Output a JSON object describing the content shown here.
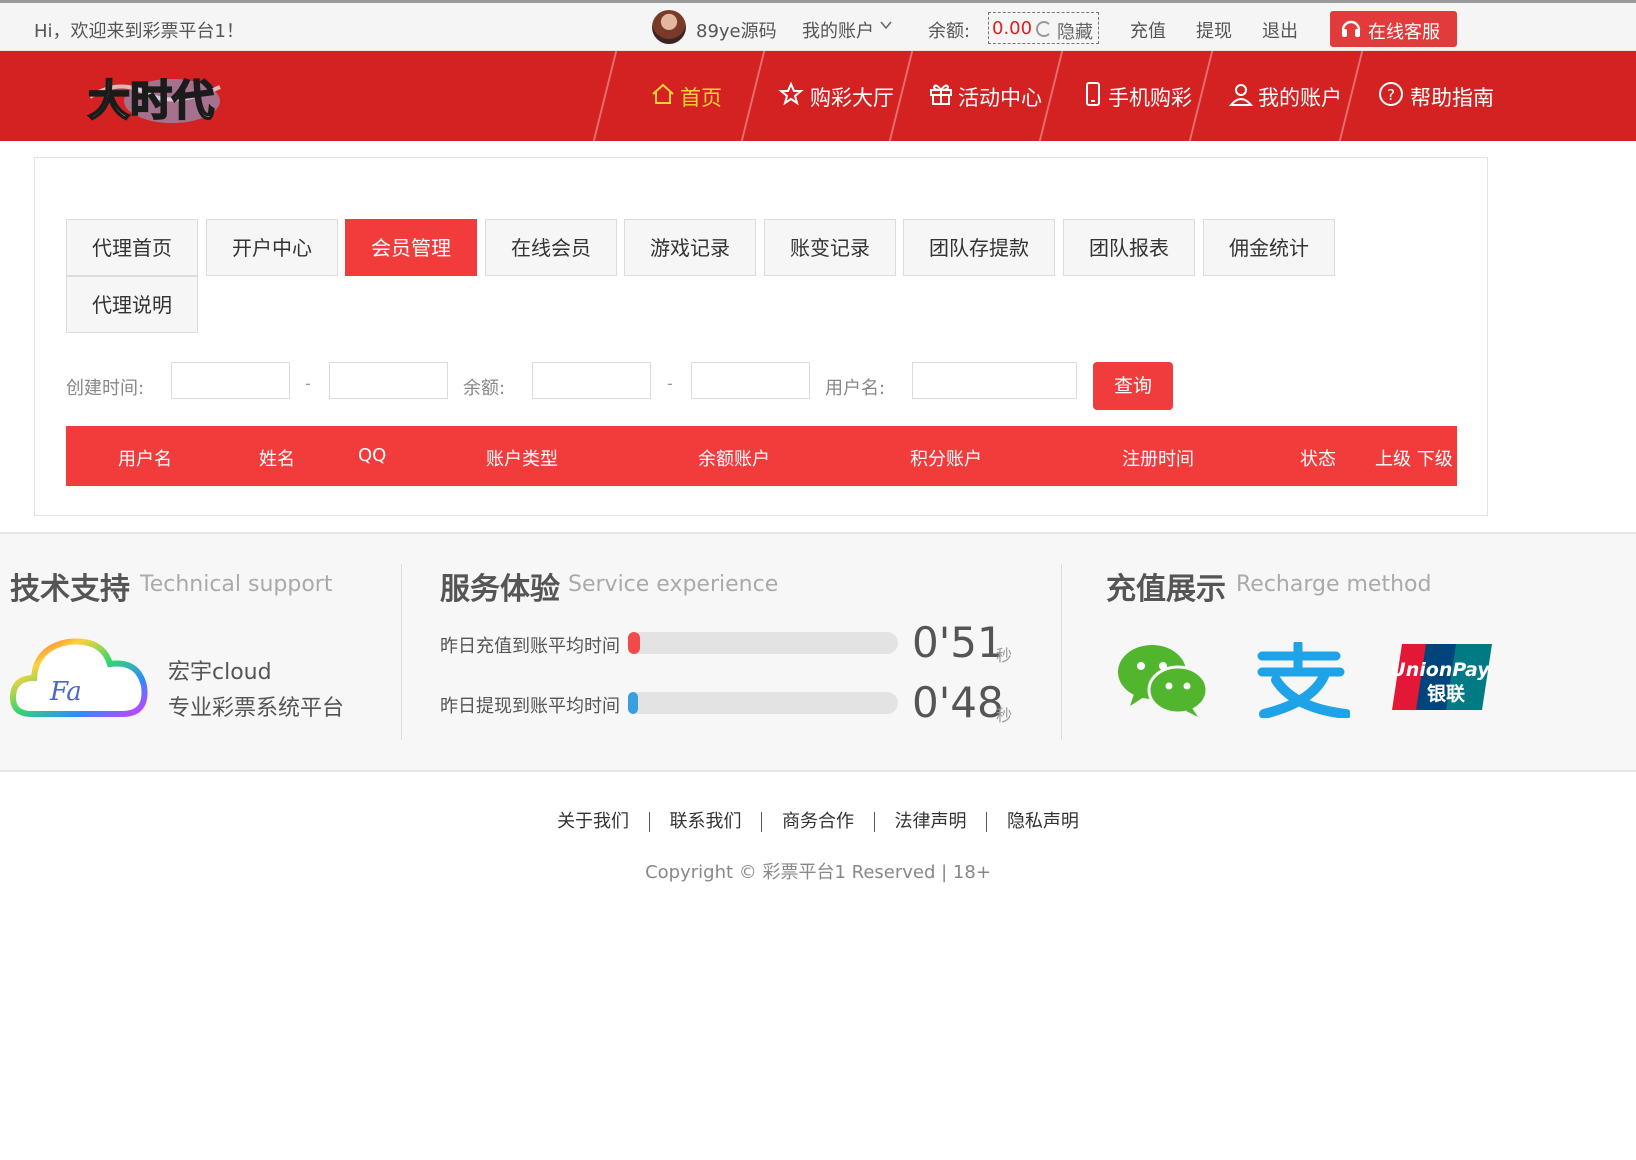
{
  "topbar": {
    "greeting": "Hi，欢迎来到彩票平台1！",
    "username": "89ye源码",
    "my_account": "我的账户",
    "balance_label": "余额:",
    "balance_value": "0.00",
    "hide_label": "隐藏",
    "recharge": "充值",
    "withdraw": "提现",
    "logout": "退出",
    "service": "在线客服"
  },
  "nav": {
    "items": [
      {
        "label": "首页",
        "icon": "home-icon"
      },
      {
        "label": "购彩大厅",
        "icon": "star-icon"
      },
      {
        "label": "活动中心",
        "icon": "gift-icon"
      },
      {
        "label": "手机购彩",
        "icon": "phone-icon"
      },
      {
        "label": "我的账户",
        "icon": "user-icon"
      },
      {
        "label": "帮助指南",
        "icon": "help-icon"
      }
    ],
    "active_color": "#ffd23a"
  },
  "tabs": [
    {
      "label": "代理首页"
    },
    {
      "label": "开户中心"
    },
    {
      "label": "会员管理",
      "active": true
    },
    {
      "label": "在线会员"
    },
    {
      "label": "游戏记录"
    },
    {
      "label": "账变记录"
    },
    {
      "label": "团队存提款"
    },
    {
      "label": "团队报表"
    },
    {
      "label": "佣金统计"
    },
    {
      "label": "代理说明"
    }
  ],
  "filters": {
    "created_label": "创建时间:",
    "balance_label": "余额:",
    "username_label": "用户名:",
    "separator": "-",
    "query_button": "查询"
  },
  "table": {
    "headers": [
      "用户名",
      "姓名",
      "QQ",
      "账户类型",
      "余额账户",
      "积分账户",
      "注册时间",
      "状态",
      "上级 下级"
    ],
    "rows": []
  },
  "footer": {
    "tech": {
      "title": "技术支持",
      "subtitle": "Technical support",
      "name": "宏宇cloud",
      "desc": "专业彩票系统平台"
    },
    "service": {
      "title": "服务体验",
      "subtitle": "Service experience",
      "stats": [
        {
          "label": "昨日充值到账平均时间",
          "value": "0'51",
          "unit": "秒",
          "color": "#f04a4a"
        },
        {
          "label": "昨日提现到账平均时间",
          "value": "0'48",
          "unit": "秒",
          "color": "#3a9fe0"
        }
      ]
    },
    "recharge": {
      "title": "充值展示",
      "subtitle": "Recharge method",
      "methods": [
        "wechat-icon",
        "alipay-icon",
        "unionpay-icon"
      ],
      "unionpay_text": "UnionPay",
      "unionpay_cn": "银联"
    },
    "links": [
      "关于我们",
      "联系我们",
      "商务合作",
      "法律声明",
      "隐私声明"
    ],
    "copyright": "Copyright © 彩票平台1 Reserved | 18+"
  },
  "colors": {
    "brand_red": "#d42222",
    "tab_active": "#f23c3c",
    "query_button": "#f03c3c"
  }
}
